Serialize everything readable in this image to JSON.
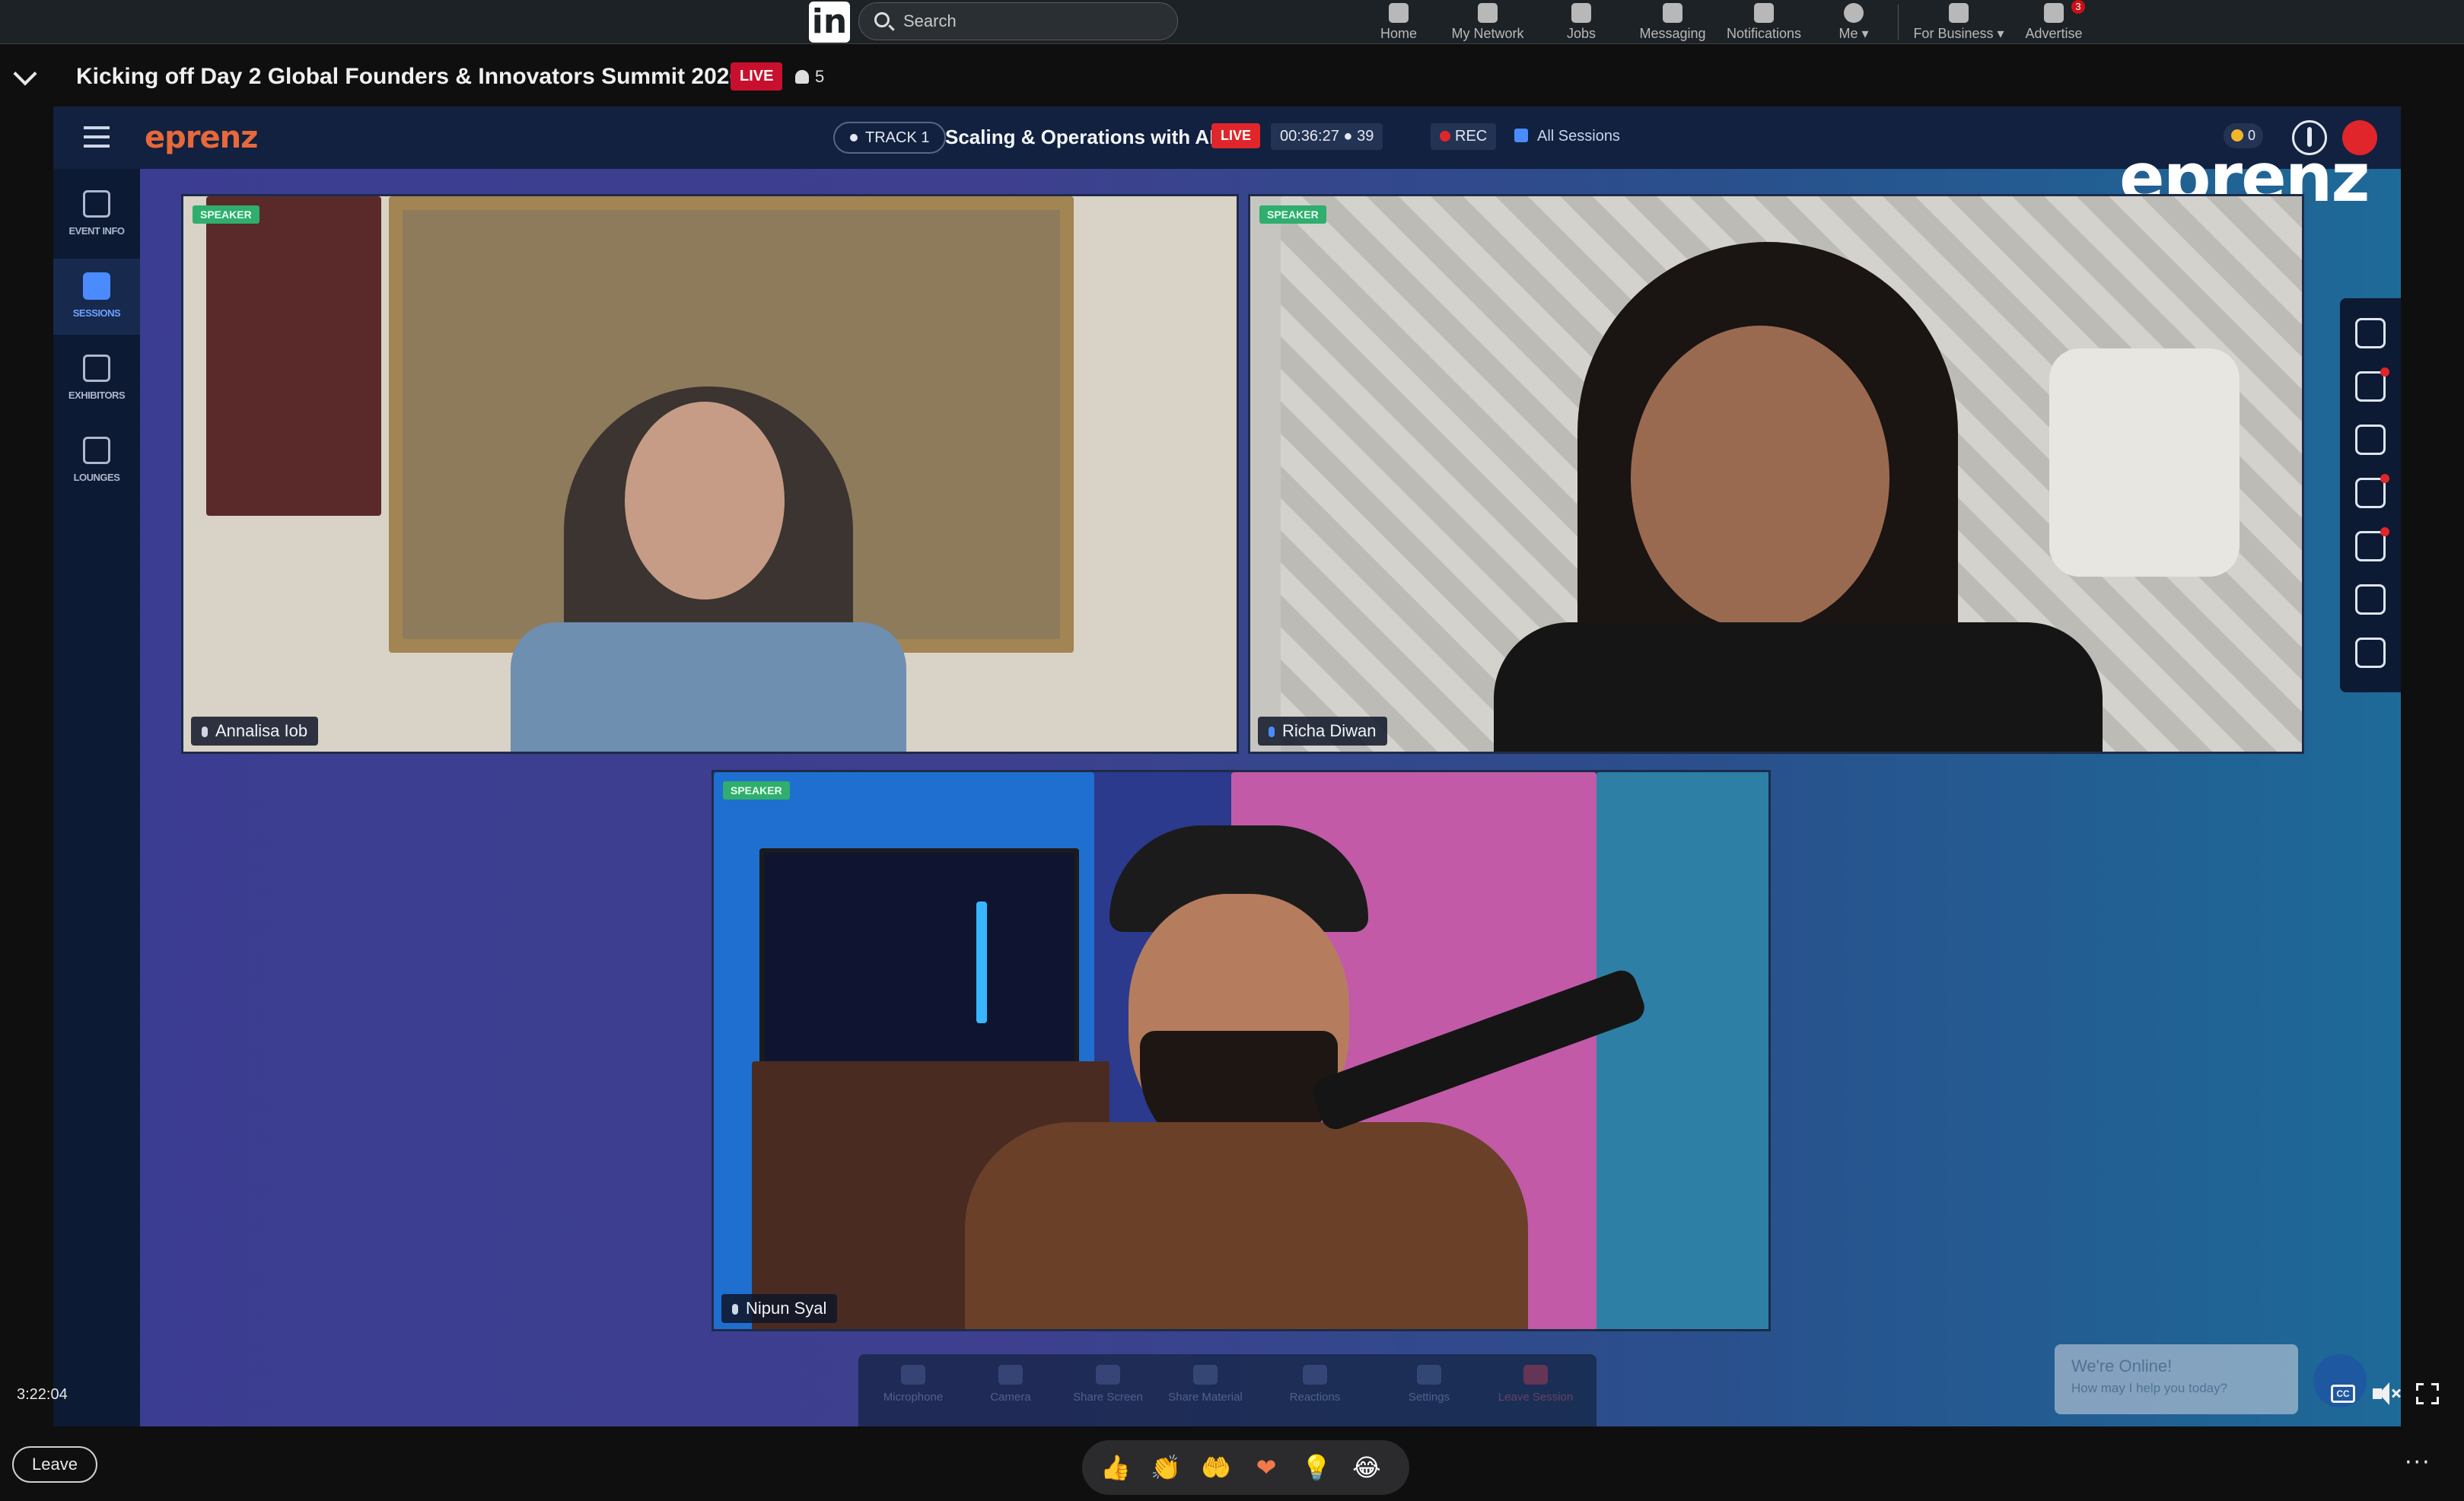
{
  "linkedin_nav": {
    "logo": "in",
    "search_placeholder": "Search",
    "items": [
      {
        "label": "Home",
        "icon": "home-icon",
        "badge": ""
      },
      {
        "label": "My Network",
        "icon": "network-icon",
        "badge": ""
      },
      {
        "label": "Jobs",
        "icon": "briefcase-icon",
        "badge": ""
      },
      {
        "label": "Messaging",
        "icon": "message-icon",
        "badge": ""
      },
      {
        "label": "Notifications",
        "icon": "bell-icon",
        "badge": ""
      },
      {
        "label": "Me",
        "icon": "avatar-icon",
        "badge": ""
      },
      {
        "label": "For Business",
        "icon": "grid-icon",
        "badge": ""
      },
      {
        "label": "Advertise",
        "icon": "advertise-icon",
        "badge": "3"
      }
    ]
  },
  "event": {
    "title": "Kicking off Day 2 Global Founders & Innovators Summit 2026",
    "live_label": "LIVE",
    "viewer_count": "5"
  },
  "eprenz": {
    "logo_small": "eprenz",
    "watermark": "eprenz",
    "track_label": "TRACK 1",
    "session_title": "Scaling & Operations with AI",
    "live_label": "LIVE",
    "timer": "00:36:27",
    "attendees": "39",
    "rec_label": "REC",
    "all_sessions_label": "All Sessions",
    "coins": "0",
    "rail": [
      {
        "label": "EVENT INFO",
        "icon": "calendar-icon"
      },
      {
        "label": "SESSIONS",
        "icon": "play-icon"
      },
      {
        "label": "EXHIBITORS",
        "icon": "booth-icon"
      },
      {
        "label": "LOUNGES",
        "icon": "lounge-icon"
      }
    ],
    "right_rail_icons": [
      "profile-icon",
      "people-icon",
      "poll-icon",
      "question-icon",
      "chat-icon",
      "support-icon",
      "share-icon"
    ],
    "speakers": [
      {
        "tag": "SPEAKER",
        "name": "Annalisa Iob"
      },
      {
        "tag": "SPEAKER",
        "name": "Richa Diwan"
      },
      {
        "tag": "SPEAKER",
        "name": "Nipun Syal"
      }
    ],
    "controls": [
      "Microphone",
      "Camera",
      "Share Screen",
      "Share Material",
      "Reactions",
      "Settings",
      "Leave Session"
    ],
    "chat_widget": {
      "line1": "We're Online!",
      "line2": "How may I help you today?"
    }
  },
  "player": {
    "timestamp": "3:22:04",
    "cc_label": "CC"
  },
  "bottom": {
    "leave_label": "Leave",
    "reactions": [
      "👍",
      "👏",
      "🤲",
      "❤",
      "💡",
      "😂"
    ],
    "more_label": "···"
  },
  "colors": {
    "live_red": "#c8102e",
    "eprenz_orange": "#e7683a",
    "speaker_green": "#2fae6d",
    "accent_blue": "#4a8cff"
  }
}
